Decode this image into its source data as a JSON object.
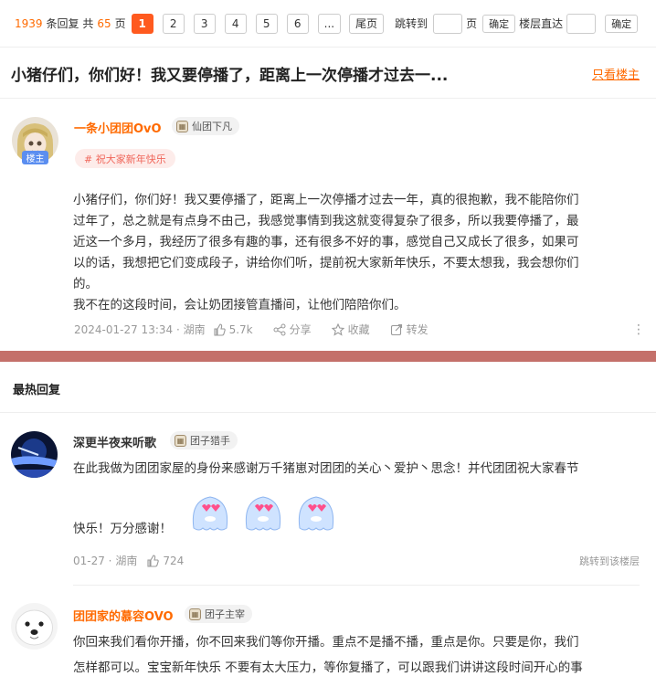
{
  "pager": {
    "total_replies": "1939",
    "replies_label": "条回复 共",
    "total_pages": "65",
    "pages_label": "页",
    "pages": [
      "1",
      "2",
      "3",
      "4",
      "5",
      "6",
      "..."
    ],
    "last_label": "尾页",
    "jump_label": "跳转到",
    "page_unit": "页",
    "confirm_label": "确定",
    "floor_label": "楼层直达",
    "confirm2_label": "确定"
  },
  "thread": {
    "title": "小猪仔们，你们好！我又要停播了，距离上一次停播才过去一...",
    "only_op_label": "只看楼主"
  },
  "main_post": {
    "username": "一条小团团OvO",
    "op_badge": "楼主",
    "title_badge": "仙团下凡",
    "topic_tag": "#  祝大家新年快乐",
    "body_lines": [
      "小猪仔们，你们好！我又要停播了，距离上一次停播才过去一年，真的很抱歉，我不能陪你们",
      "过年了，总之就是有点身不由己，我感觉事情到我这就变得复杂了很多，所以我要停播了，最",
      "近这一个多月，我经历了很多有趣的事，还有很多不好的事，感觉自己又成长了很多，如果可",
      "以的话，我想把它们变成段子，讲给你们听，提前祝大家新年快乐，不要太想我，我会想你们",
      "的。",
      "我不在的这段时间，会让奶团接管直播间，让他们陪陪你们。"
    ],
    "timestamp": "2024-01-27 13:34 · 湖南",
    "likes": "5.7k",
    "share_label": "分享",
    "fav_label": "收藏",
    "repost_label": "转发"
  },
  "hot": {
    "header": "最热回复",
    "replies": [
      {
        "username": "深更半夜来听歌",
        "badge": "团子猎手",
        "line1": "在此我做为团团家屋的身份来感谢万千猪崽对团团的关心丶爱护丶思念！并代团团祝大家春节",
        "line2": "快乐！万分感谢！",
        "timestamp": "01-27 · 湖南",
        "likes": "724",
        "jump_label": "跳转到该楼层"
      },
      {
        "username": "团团家的慕容OVO",
        "badge": "团子主宰",
        "line1": "你回来我们看你开播，你不回来我们等你开播。重点不是播不播，重点是你。只要是你，我们",
        "line2": "怎样都可以。宝宝新年快乐 不要有太大压力，等你复播了，可以跟我们讲讲这段时间开心的事"
      }
    ]
  },
  "colors": {
    "accent": "#ff6a00",
    "page_active": "#ff5a1f",
    "op_badge": "#5b8ef0",
    "topic_bg": "#fdecea",
    "topic_text": "#f0665a",
    "band": "#c4706a"
  }
}
